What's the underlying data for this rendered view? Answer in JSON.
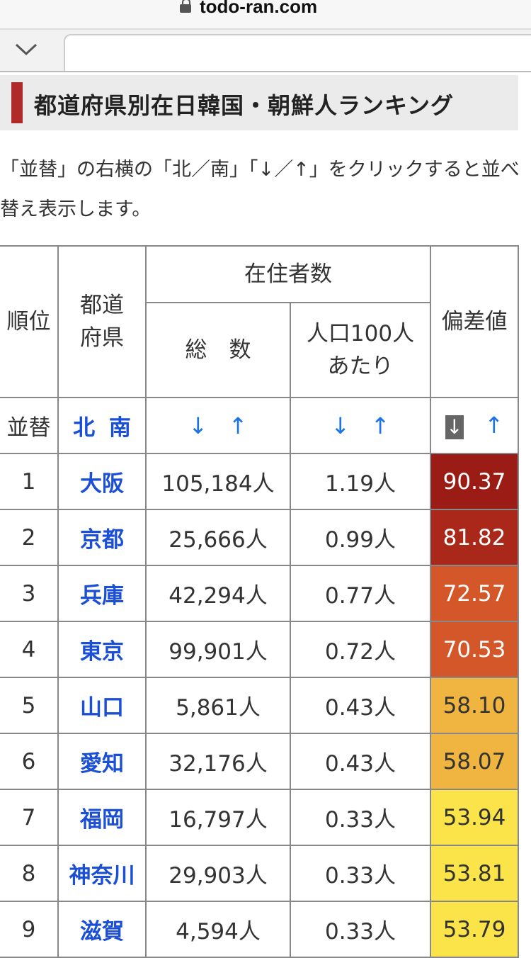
{
  "browser": {
    "domain": "todo-ran.com"
  },
  "heading": {
    "title": "都道府県別在日韓国・朝鮮人ランキング"
  },
  "description": "「並替」の右横の「北／南」「↓／↑」をクリックすると並べ替え表示します。",
  "table": {
    "header": {
      "rank": "順位",
      "pref": "都道\n府県",
      "residents": "在住者数",
      "total": "総　数",
      "per100": "人口100人\nあたり",
      "deviation": "偏差値"
    },
    "sort_row": {
      "label": "並替",
      "north": "北",
      "south": "南",
      "down": "↓",
      "up": "↑"
    },
    "rows": [
      {
        "rank": "1",
        "pref": "大阪",
        "total": "105,184人",
        "per100": "1.19人",
        "deviation": "90.37",
        "color": "#9b1c14"
      },
      {
        "rank": "2",
        "pref": "京都",
        "total": "25,666人",
        "per100": "0.99人",
        "deviation": "81.82",
        "color": "#a9281a"
      },
      {
        "rank": "3",
        "pref": "兵庫",
        "total": "42,294人",
        "per100": "0.77人",
        "deviation": "72.57",
        "color": "#d4572a"
      },
      {
        "rank": "4",
        "pref": "東京",
        "total": "99,901人",
        "per100": "0.72人",
        "deviation": "70.53",
        "color": "#d4572a"
      },
      {
        "rank": "5",
        "pref": "山口",
        "total": "5,861人",
        "per100": "0.43人",
        "deviation": "58.10",
        "color": "#efb540"
      },
      {
        "rank": "6",
        "pref": "愛知",
        "total": "32,176人",
        "per100": "0.43人",
        "deviation": "58.07",
        "color": "#efb540"
      },
      {
        "rank": "7",
        "pref": "福岡",
        "total": "16,797人",
        "per100": "0.33人",
        "deviation": "53.94",
        "color": "#fbe34a"
      },
      {
        "rank": "8",
        "pref": "神奈川",
        "total": "29,903人",
        "per100": "0.33人",
        "deviation": "53.81",
        "color": "#fbe34a"
      },
      {
        "rank": "9",
        "pref": "滋賀",
        "total": "4,594人",
        "per100": "0.33人",
        "deviation": "53.79",
        "color": "#fbe34a"
      }
    ]
  }
}
